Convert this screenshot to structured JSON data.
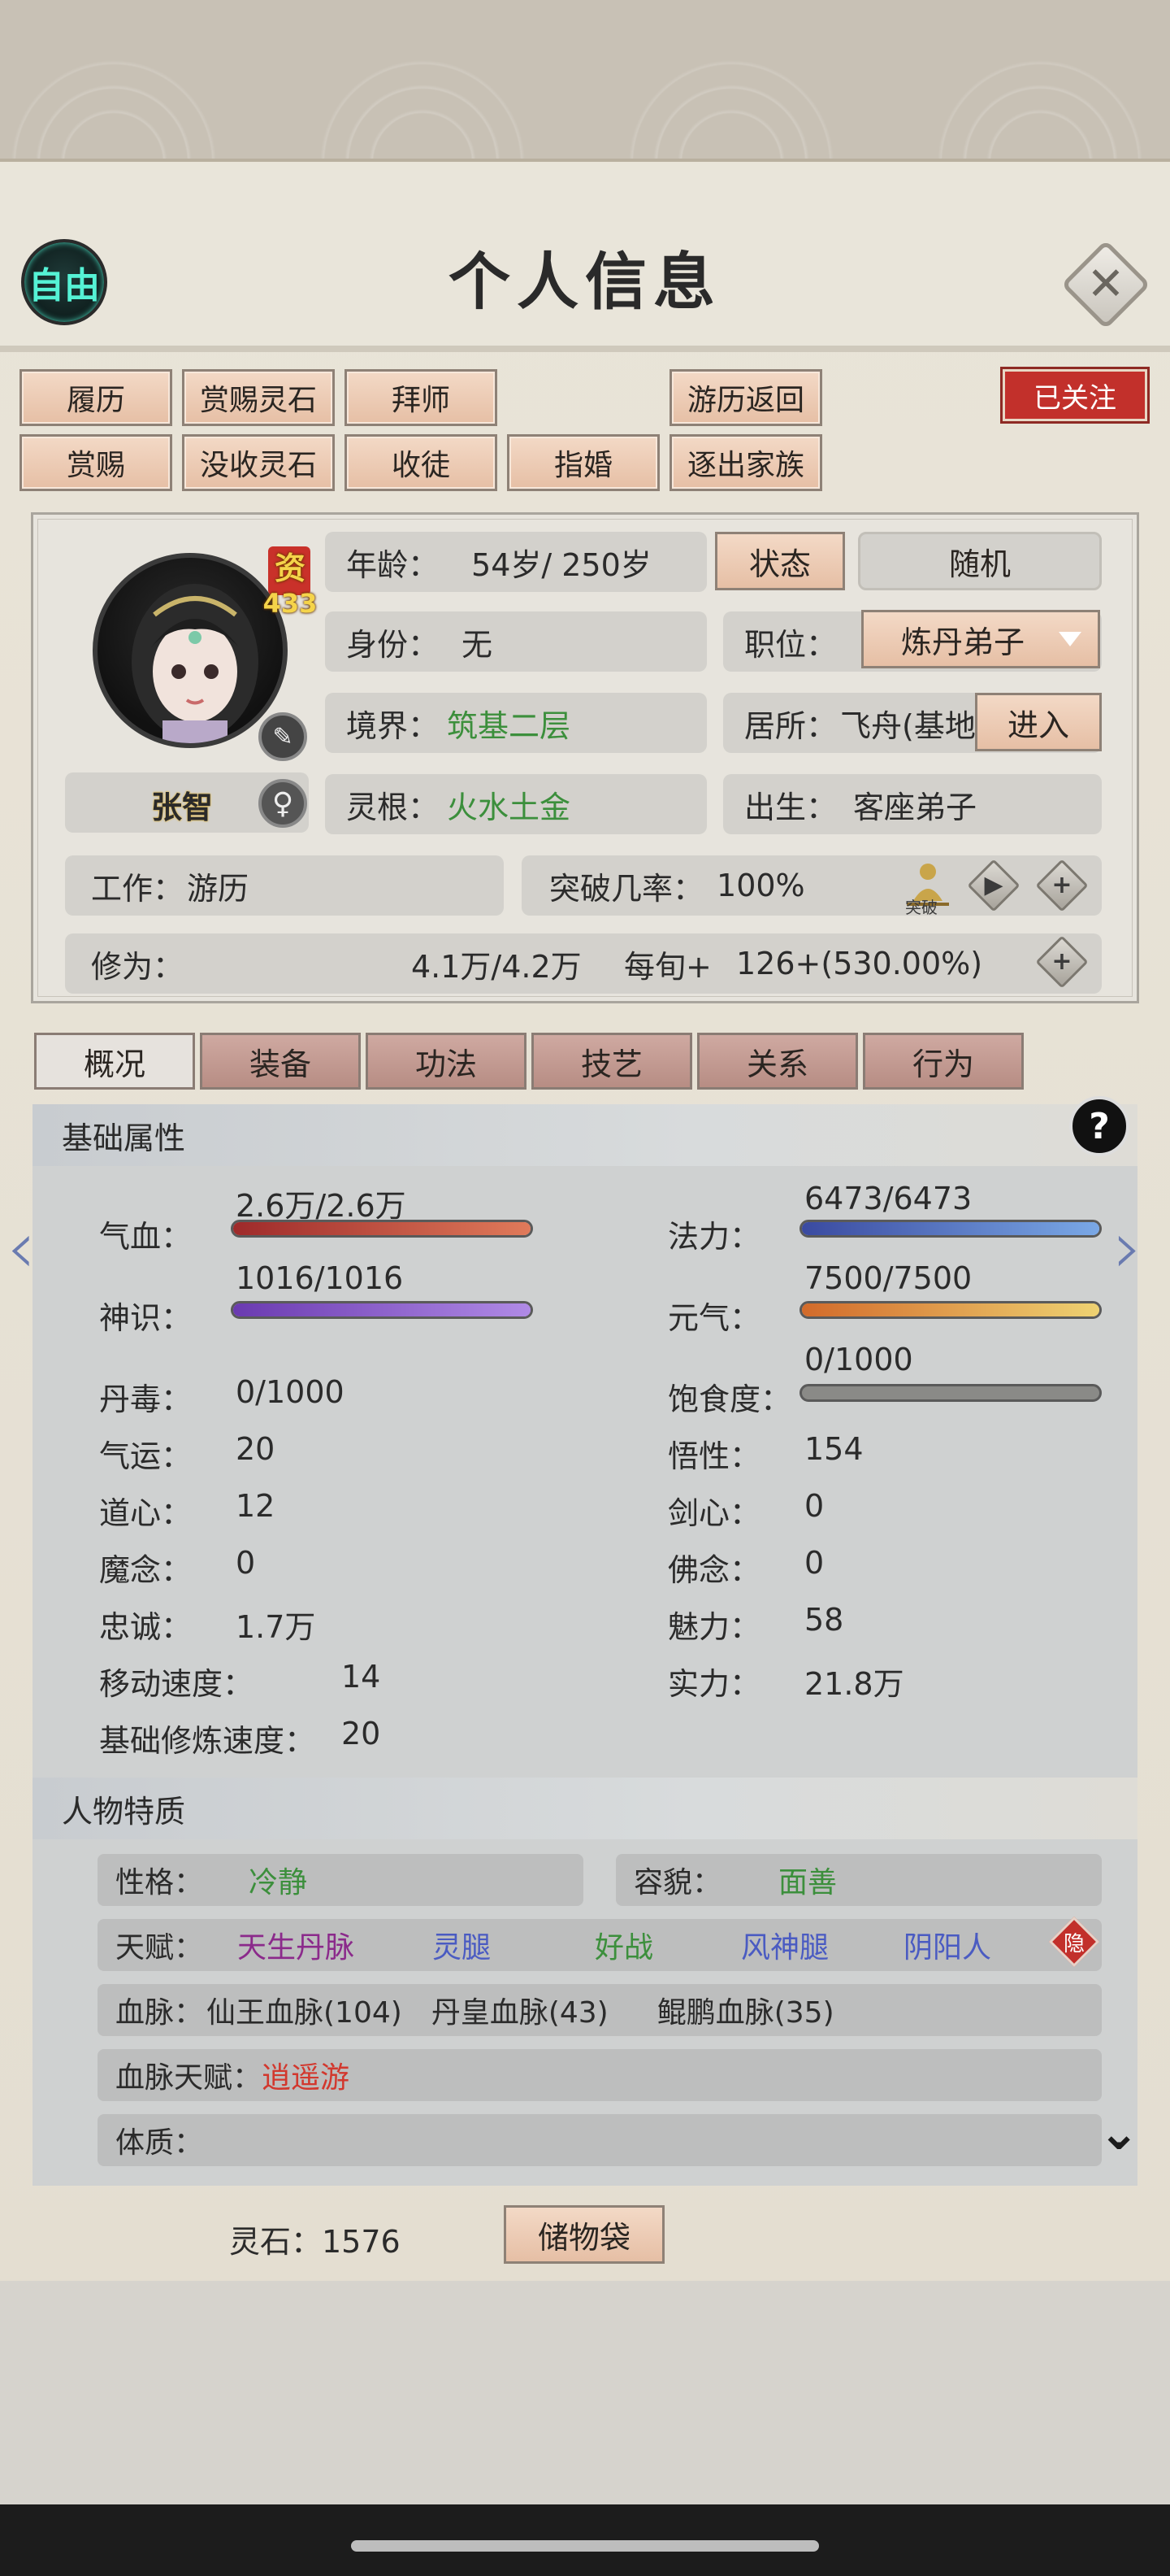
{
  "header": {
    "mode_badge": "自由",
    "title": "个人信息"
  },
  "actions": {
    "row1": [
      "履历",
      "赏赐灵石",
      "拜师",
      "游历返回"
    ],
    "row2": [
      "赏赐",
      "没收灵石",
      "收徒",
      "指婚",
      "逐出家族"
    ],
    "followed": "已关注"
  },
  "profile": {
    "aptitude_label": "资",
    "aptitude_value": "433",
    "name": "张智",
    "age_label": "年龄：",
    "age_value": "54岁/ 250岁",
    "status_button": "状态",
    "random_button": "随机",
    "identity_label": "身份：",
    "identity_value": "无",
    "position_label": "职位：",
    "position_value": "炼丹弟子",
    "realm_label": "境界：",
    "realm_value": "筑基二层",
    "residence_label": "居所：",
    "residence_value": "飞舟(基地",
    "enter_button": "进入",
    "spirit_root_label": "灵根：",
    "spirit_root_value": "火水土金",
    "birth_label": "出生：",
    "birth_value": "客座弟子",
    "work_label": "工作：",
    "work_value": "游历",
    "breakthrough_label": "突破几率：",
    "breakthrough_value": "100%",
    "breakthrough_icon_text": "突破",
    "cultivation_label": "修为：",
    "cultivation_value": "4.1万/4.2万",
    "per_tick_label": "每旬+",
    "per_tick_value": "126+(530.00%)"
  },
  "tabs": [
    "概况",
    "装备",
    "功法",
    "技艺",
    "关系",
    "行为"
  ],
  "stats": {
    "section_title": "基础属性",
    "help": "?",
    "hp_label": "气血：",
    "hp_value": "2.6万/2.6万",
    "mana_label": "法力：",
    "mana_value": "6473/6473",
    "spirit_label": "神识：",
    "spirit_value": "1016/1016",
    "vitality_label": "元气：",
    "vitality_value": "7500/7500",
    "poison_label": "丹毒：",
    "poison_value": "0/1000",
    "satiety_label": "饱食度：",
    "satiety_value": "0/1000",
    "luck_label": "气运：",
    "luck_value": "20",
    "insight_label": "悟性：",
    "insight_value": "154",
    "dao_label": "道心：",
    "dao_value": "12",
    "sword_label": "剑心：",
    "sword_value": "0",
    "demon_label": "魔念：",
    "demon_value": "0",
    "buddha_label": "佛念：",
    "buddha_value": "0",
    "loyalty_label": "忠诚：",
    "loyalty_value": "1.7万",
    "charm_label": "魅力：",
    "charm_value": "58",
    "speed_label": "移动速度：",
    "speed_value": "14",
    "power_label": "实力：",
    "power_value": "21.8万",
    "train_speed_label": "基础修炼速度：",
    "train_speed_value": "20",
    "bars": {
      "hp": 1.0,
      "mana": 1.0,
      "spirit": 1.0,
      "vitality": 1.0,
      "satiety": 0.0
    }
  },
  "traits": {
    "section_title": "人物特质",
    "personality_label": "性格：",
    "personality_value": "冷静",
    "appearance_label": "容貌：",
    "appearance_value": "面善",
    "talent_label": "天赋：",
    "talents": [
      {
        "text": "天生丹脉",
        "color": "#8b2a8b"
      },
      {
        "text": "灵腿",
        "color": "#4a5bc2"
      },
      {
        "text": "好战",
        "color": "#3c8f3c"
      },
      {
        "text": "风神腿",
        "color": "#4a5bc2"
      },
      {
        "text": "阴阳人",
        "color": "#4a5bc2"
      }
    ],
    "hide_badge": "隐",
    "bloodline_label": "血脉：",
    "bloodlines": [
      "仙王血脉(104)",
      "丹皇血脉(43)",
      "鲲鹏血脉(35)"
    ],
    "bloodline_talent_label": "血脉天赋：",
    "bloodline_talent_value": "逍遥游",
    "physique_label": "体质："
  },
  "footer": {
    "spirit_stone_label": "灵石：1576",
    "storage_button": "储物袋"
  }
}
